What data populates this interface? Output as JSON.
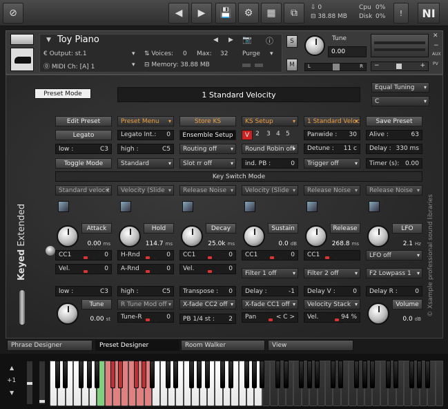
{
  "topbar": {
    "mem_count": "0",
    "mem_size": "38.88 MB",
    "cpu_label": "Cpu",
    "cpu_value": "0%",
    "disk_label": "Disk",
    "disk_value": "0%",
    "logo_text": "NI"
  },
  "header": {
    "instrument_name": "Toy Piano",
    "output_label": "Output:",
    "output_value": "st.1",
    "voices_label": "Voices:",
    "voices_value": "0",
    "max_label": "Max:",
    "max_value": "32",
    "purge_label": "Purge",
    "midi_label": "MIDI Ch:",
    "midi_value": "[A]  1",
    "memory_label": "Memory:",
    "memory_value": "38.88 MB",
    "s_label": "S",
    "m_label": "M",
    "tune_label": "Tune",
    "tune_value": "0.00",
    "pan_l": "L",
    "pan_r": "R",
    "aux_label": "AUX",
    "pv_label": "PV"
  },
  "main": {
    "preset_mode": "Preset Mode",
    "velocity_display": "1 Standard Velocity",
    "tuning_dd": "Equal Tuning",
    "key_dd": "C",
    "row1": [
      "Edit Preset",
      "Preset Menu",
      "Store KS",
      "KS Setup",
      "1 Standard Velocity",
      "Save Preset"
    ],
    "legato": "Legato",
    "legato_int_label": "Legato Int.:",
    "legato_int_value": "0",
    "ensemble_setup": "Ensemble Setup",
    "ks_numbers": [
      "V",
      "2",
      "3",
      "4",
      "5"
    ],
    "panwide_label": "Panwide :",
    "panwide_value": "30",
    "alive_label": "Alive :",
    "alive_value": "63",
    "low_label": "low :",
    "low_value": "C3",
    "high_label": "high :",
    "high_value": "C5",
    "routing_off": "Routing off",
    "round_robin_off": "Round Robin off",
    "detune_label": "Detune :",
    "detune_value": "11 c",
    "delay_label": "Delay :",
    "delay_value": "330 ms",
    "toggle_mode": "Toggle Mode",
    "standard": "Standard",
    "slot_rr_off": "Slot rr off",
    "ind_pb_label": "ind. PB :",
    "ind_pb_value": "0",
    "trigger_off": "Trigger off",
    "timer_label": "Timer (s):",
    "timer_value": "0.00",
    "ks_mode": "Key Switch Mode",
    "slot_dd": [
      "Standard velocit",
      "Velocity (Slide",
      "Release Noise",
      "Velocity (Slide",
      "Release Noise",
      "Release Noise"
    ],
    "knobs": [
      {
        "label": "Attack",
        "value": "0.00",
        "unit": "ms"
      },
      {
        "label": "Hold",
        "value": "114.7",
        "unit": "ms"
      },
      {
        "label": "Decay",
        "value": "25.0k",
        "unit": "ms"
      },
      {
        "label": "Sustain",
        "value": "0.0",
        "unit": "dB"
      },
      {
        "label": "Release",
        "value": "268.8",
        "unit": "ms"
      },
      {
        "label": "LFO",
        "value": "2.1",
        "unit": "Hz"
      }
    ],
    "cc1_label": "CC1",
    "cc1_value": "0",
    "hrnd_label": "H-Rnd",
    "hrnd_value": "0",
    "cc1b_value": "0",
    "cc1c_value": "0",
    "lfo_off": "LFO off",
    "vel_label": "Vel.",
    "vel_value": "0",
    "arnd_label": "A-Rnd",
    "arnd_value": "0",
    "velb_value": "0",
    "filter1": "Filter 1 off",
    "filter2": "Filter 2 off",
    "f2_lowpass": "F2 Lowpass 1",
    "low2_label": "low :",
    "low2_value": "C3",
    "high2_label": "high :",
    "high2_value": "C5",
    "transpose_label": "Transpose :",
    "transpose_value": "0",
    "delay2_label": "Delay :",
    "delay2_value": "-1",
    "delay_v_label": "Delay V :",
    "delay_v_value": "0",
    "delay_r_label": "Delay R :",
    "delay_r_value": "0",
    "tune_k_label": "Tune",
    "tune_k_value": "0.00",
    "tune_k_unit": "st",
    "r_tune_mod": "R Tune Mod off",
    "xfade2": "X-fade CC2 off",
    "xfade1": "X-fade CC1 off",
    "velocity_stack": "Velocity Stack",
    "volume_label": "Volume",
    "volume_value": "0.0",
    "volume_unit": "dB",
    "tune_r_label": "Tune-R",
    "tune_r_value": "0",
    "pb_label": "PB 1/4 st :",
    "pb_value": "2",
    "pan_label": "Pan",
    "pan_value": "< C >",
    "vel2_label": "Vel.",
    "vel2_value": "94 %",
    "side_keyed": "Keyed",
    "side_extended": "Extended",
    "copyright": "© Xsample professional sound libraries"
  },
  "tabs": [
    "Phrase Designer",
    "Preset Designer",
    "Room Walker",
    "View"
  ],
  "keyboard": {
    "octave": "+1"
  },
  "colors": {
    "accent_orange": "#f0a040",
    "key_red": "#e08080",
    "key_green": "#80d080",
    "ks_red": "#cc2222"
  }
}
